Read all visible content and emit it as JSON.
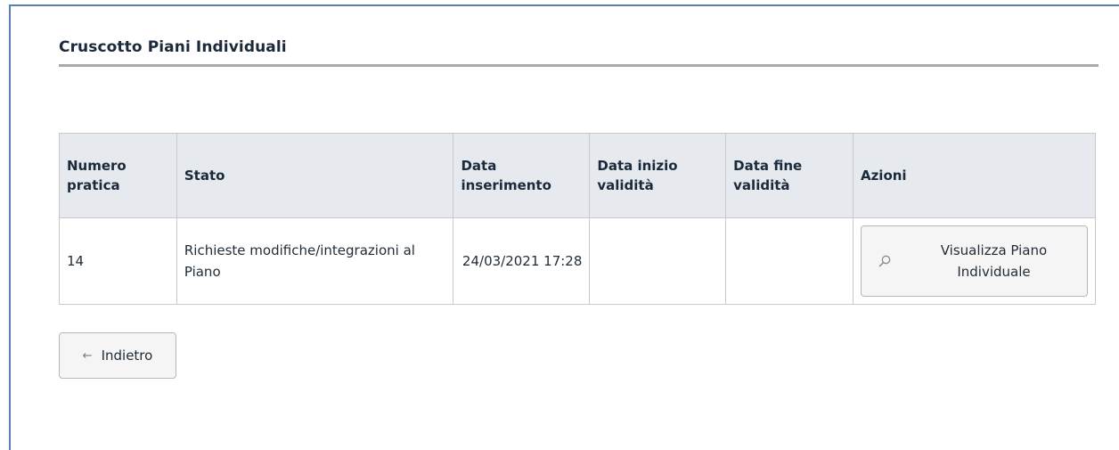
{
  "page": {
    "title": "Cruscotto Piani Individuali"
  },
  "table": {
    "headers": {
      "numero_pratica": "Numero pratica",
      "stato": "Stato",
      "data_inserimento": "Data inserimento",
      "data_inizio_validita": "Data inizio validità",
      "data_fine_validita": "Data fine validità",
      "azioni": "Azioni"
    },
    "rows": [
      {
        "numero_pratica": "14",
        "stato": "Richieste modifiche/integrazioni al Piano",
        "data_inserimento": "24/03/2021 17:28",
        "data_inizio_validita": "",
        "data_fine_validita": "",
        "action_label": "Visualizza Piano Individuale",
        "action_icon": "search-icon"
      }
    ]
  },
  "back_button": {
    "label": "Indietro",
    "icon": "arrow-left-icon"
  },
  "colors": {
    "frame_border": "#5b7fb5",
    "header_bg": "#e6e9ee",
    "title_rule": "#a9a9a9"
  }
}
